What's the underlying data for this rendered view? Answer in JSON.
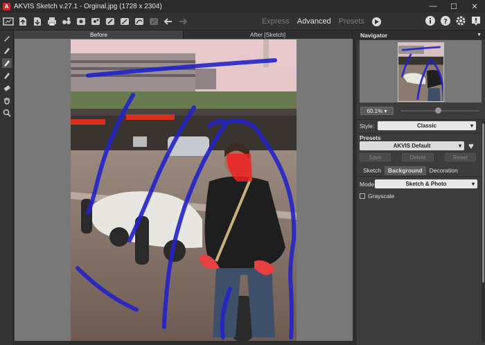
{
  "titlebar": {
    "title": "AKVIS Sketch v.27.1 - Orginal.jpg (1728 x 2304)",
    "minimize": "—",
    "maximize": "☐",
    "close": "✕"
  },
  "toolbar": {
    "modes": [
      "Express",
      "Advanced",
      "Presets"
    ],
    "active_mode": "Advanced"
  },
  "tabs": {
    "before": "Before",
    "after": "After [Sketch]"
  },
  "panel": {
    "navigator": "Navigator",
    "zoom": "60.1%",
    "style_label": "Style:",
    "style_value": "Classic",
    "presets_label": "Presets",
    "preset_value": "AKVIS Default",
    "save": "Save",
    "delete": "Delete",
    "reset": "Reset",
    "subtabs": [
      "Sketch",
      "Background",
      "Decoration"
    ],
    "active_subtab": "Background",
    "mode_label": "Mode:",
    "mode_value": "Sketch & Photo",
    "grayscale": "Grayscale"
  },
  "colors": {
    "stroke_blue": "#2323c8",
    "stroke_red": "#ee2222",
    "accent": "#c62828"
  }
}
